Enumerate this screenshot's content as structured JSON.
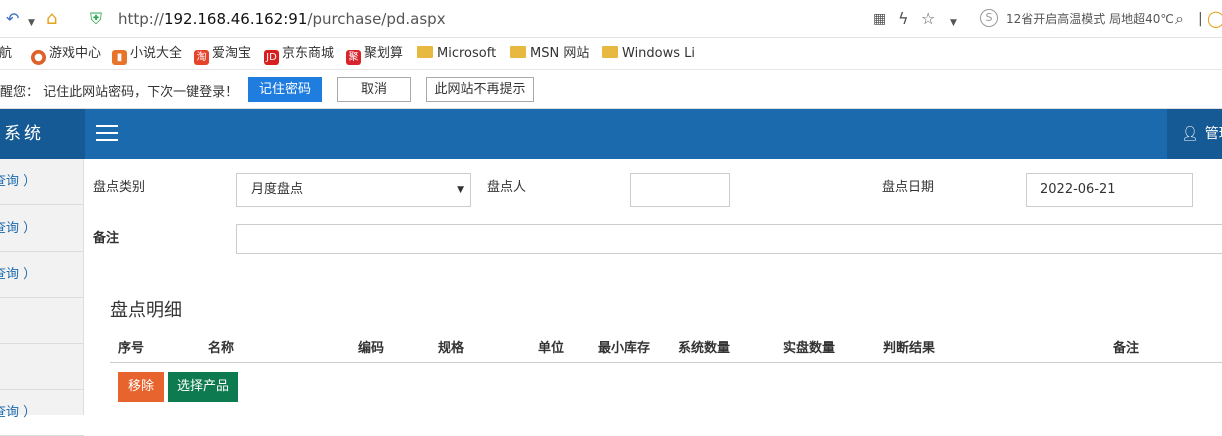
{
  "browser": {
    "url_prefix": "http://",
    "url_host": "192.168.46.162:91",
    "url_path": "/purchase/pd.aspx",
    "news": "12省开启高温模式 局地超40℃",
    "news_icon": "S"
  },
  "bookmarks": [
    {
      "label": "导航",
      "icon": "nav-icon"
    },
    {
      "label": "游戏中心",
      "icon": "game-icon",
      "color": "#e0602a"
    },
    {
      "label": "小说大全",
      "icon": "novel-icon",
      "color": "#e8742a"
    },
    {
      "label": "爱淘宝",
      "icon": "taobao-icon",
      "color": "#e5432a"
    },
    {
      "label": "京东商城",
      "icon": "jd-icon",
      "color": "#d71f1f"
    },
    {
      "label": "聚划算",
      "icon": "juhuasuan-icon",
      "color": "#d8232c"
    },
    {
      "label": "Microsoft",
      "icon": "folder-icon"
    },
    {
      "label": "MSN 网站",
      "icon": "folder-icon"
    },
    {
      "label": "Windows Li",
      "icon": "folder-icon"
    }
  ],
  "password_bar": {
    "message": "提醒您： 记住此网站密码，下次一键登录！",
    "remember": "记住密码",
    "cancel": "取消",
    "never": "此网站不再提示"
  },
  "app": {
    "brand": "助系统",
    "user": "管理"
  },
  "sidebar": [
    {
      "label": "查询 ）"
    },
    {
      "label": "查询 ）"
    },
    {
      "label": "查询 ）"
    },
    {
      "label": ""
    },
    {
      "label": ""
    },
    {
      "label": "查询 ）"
    }
  ],
  "form": {
    "type_label": "盘点类别",
    "type_value": "月度盘点",
    "person_label": "盘点人",
    "person_value": "",
    "date_label": "盘点日期",
    "date_value": "2022-06-21",
    "note_label": "备注",
    "note_value": ""
  },
  "detail": {
    "title": "盘点明细",
    "columns": [
      "序号",
      "名称",
      "编码",
      "规格",
      "单位",
      "最小库存",
      "系统数量",
      "实盘数量",
      "判断结果",
      "备注"
    ],
    "remove": "移除",
    "select": "选择产品"
  },
  "colors": {
    "header": "#1b6aad",
    "remove_button": "#e8642f",
    "select_button": "#0e7a50",
    "remember_button": "#1f7de0"
  }
}
